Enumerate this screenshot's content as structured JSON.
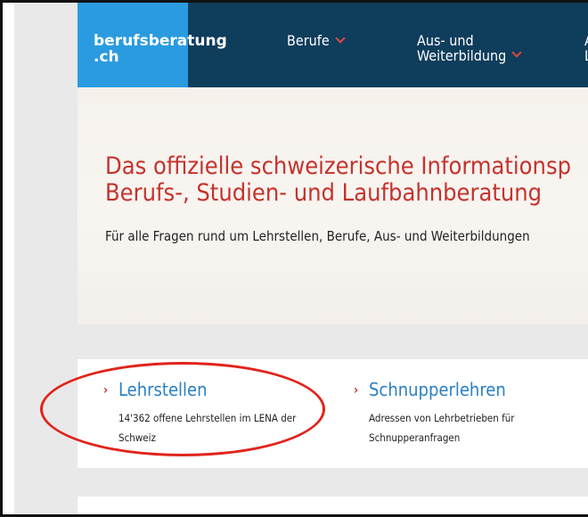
{
  "header": {
    "logo_line1": "berufsberatung",
    "logo_line2": ".ch",
    "nav": [
      {
        "label": "Berufe"
      },
      {
        "label": "Aus- und\nWeiterbildung"
      }
    ],
    "nav_cut": "A\nL"
  },
  "hero": {
    "title": "Das offizielle schweizerische Informationsp\nBerufs-, Studien- und Laufbahnberatung",
    "subtitle": "Für alle Fragen rund um Lehrstellen, Berufe, Aus- und Weiterbildungen"
  },
  "links": [
    {
      "title": "Lehrstellen",
      "description": "14'362 offene Lehrstellen im LENA der\nSchweiz"
    },
    {
      "title": "Schnupperlehren",
      "description": "Adressen von Lehrbetrieben für\nSchnupperanfragen"
    }
  ],
  "annotation": {
    "color": "#e0241c"
  },
  "colors": {
    "accent": "#c4332d",
    "header": "#0f3d5c",
    "logo": "#2a9be0",
    "link": "#2a80c2"
  }
}
